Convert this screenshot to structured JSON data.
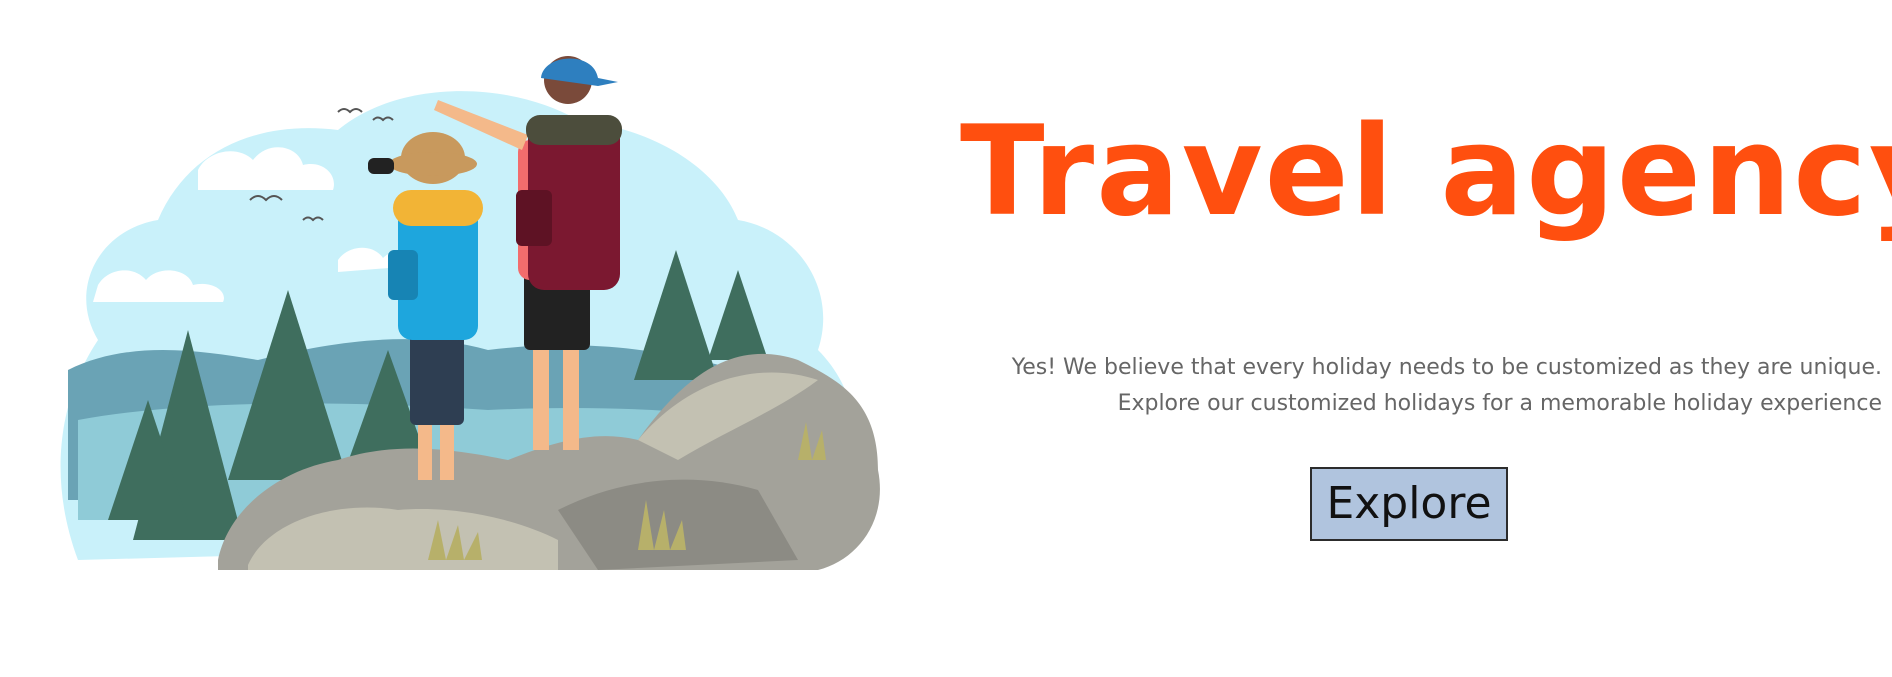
{
  "hero": {
    "title": "Travel agency",
    "subtitle_line1": "Yes! We believe that every holiday needs to be customized as they are unique.",
    "subtitle_line2": "Explore our customized holidays for a memorable holiday experience",
    "button_label": "Explore"
  },
  "illustration": {
    "icon": "hikers-on-mountain-illustration"
  },
  "colors": {
    "title": "#ff4f0f",
    "subtitle": "#666666",
    "button_bg": "#b0c4de",
    "button_border": "#2c2c2c",
    "sky": "#c9f1fa",
    "tree": "#3f6e5e",
    "rock": "#a3a29a"
  }
}
